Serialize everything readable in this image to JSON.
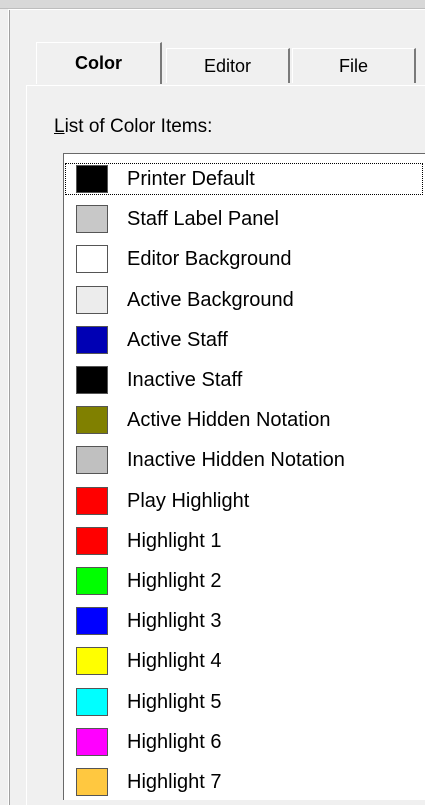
{
  "tabs": [
    {
      "label": "Color",
      "active": true
    },
    {
      "label": "Editor",
      "active": false
    },
    {
      "label": "File",
      "active": false
    }
  ],
  "list": {
    "caption_first": "L",
    "caption_rest": "ist of Color Items:",
    "items": [
      {
        "label": "Printer Default",
        "color": "#000000"
      },
      {
        "label": "Staff Label Panel",
        "color": "#c8c8c8"
      },
      {
        "label": "Editor Background",
        "color": "#ffffff"
      },
      {
        "label": "Active Background",
        "color": "#ececec"
      },
      {
        "label": "Active Staff",
        "color": "#0000b4"
      },
      {
        "label": "Inactive Staff",
        "color": "#000000"
      },
      {
        "label": "Active Hidden Notation",
        "color": "#808000"
      },
      {
        "label": "Inactive Hidden Notation",
        "color": "#c0c0c0"
      },
      {
        "label": "Play Highlight",
        "color": "#ff0000"
      },
      {
        "label": "Highlight 1",
        "color": "#ff0000"
      },
      {
        "label": "Highlight 2",
        "color": "#00ff00"
      },
      {
        "label": "Highlight 3",
        "color": "#0000ff"
      },
      {
        "label": "Highlight 4",
        "color": "#ffff00"
      },
      {
        "label": "Highlight 5",
        "color": "#00ffff"
      },
      {
        "label": "Highlight 6",
        "color": "#ff00ff"
      },
      {
        "label": "Highlight 7",
        "color": "#ffc840"
      }
    ]
  }
}
